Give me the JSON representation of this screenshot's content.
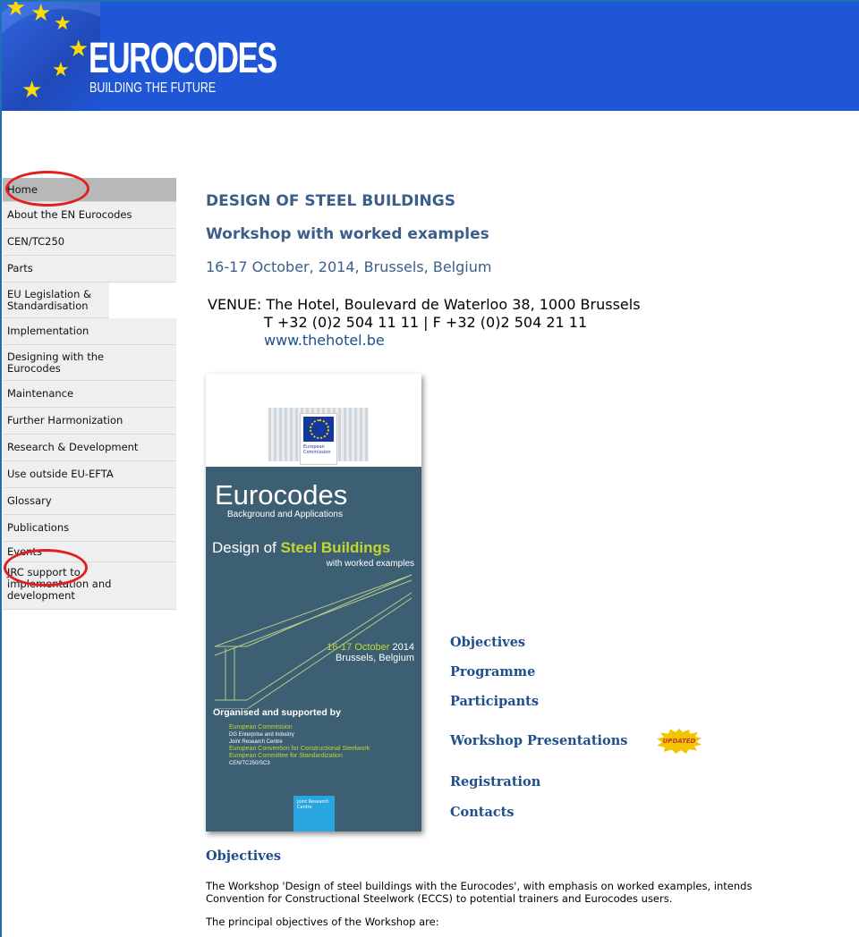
{
  "banner": {
    "logo_title": "EUROCODES",
    "logo_subtitle": "BUILDING THE FUTURE",
    "color": "#1e56d6"
  },
  "sidebar": {
    "items": [
      {
        "label": "Home"
      },
      {
        "label": "About the EN Eurocodes"
      },
      {
        "label": "CEN/TC250"
      },
      {
        "label": "Parts"
      },
      {
        "label": "EU Legislation & Standardisation"
      },
      {
        "label": "Implementation"
      },
      {
        "label": "Designing with the Eurocodes"
      },
      {
        "label": "Maintenance"
      },
      {
        "label": "Further Harmonization"
      },
      {
        "label": "Research & Development"
      },
      {
        "label": "Use outside EU-EFTA"
      },
      {
        "label": "Glossary"
      },
      {
        "label": "Publications"
      },
      {
        "label": "Events"
      },
      {
        "label": "JRC support to implementation and development"
      }
    ]
  },
  "main": {
    "title": "DESIGN OF STEEL BUILDINGS",
    "subtitle": "Workshop with worked examples",
    "dateline": "16-17 October, 2014, Brussels, Belgium",
    "venue_line1": "VENUE: The Hotel, Boulevard de Waterloo 38, 1000 Brussels",
    "venue_line2": "T +32 (0)2 504 11 11 | F +32 (0)2 504 21 11",
    "venue_link": "www.thehotel.be",
    "flyer": {
      "eu_label": "European Commission",
      "title": "Eurocodes",
      "subtitle": "Background and Applications",
      "design_prefix": "Design of ",
      "design_emph": "Steel Buildings",
      "worked": "with worked examples",
      "date_green": "16-17 October",
      "date_year": " 2014",
      "place": "Brussels, Belgium",
      "organised": "Organised and supported by",
      "org1": "European Commission",
      "org1a": "DG Enterprise and Industry",
      "org1b": "Joint Research Centre",
      "org2": "European Convention for Constructional Steelwork",
      "org3": "European Committee for Standardization",
      "org3a": "CEN/TC250/SC3",
      "jrc": "Joint Research Centre"
    },
    "links": [
      {
        "label": "Objectives"
      },
      {
        "label": "Programme"
      },
      {
        "label": "Participants"
      },
      {
        "label": "Workshop Presentations"
      },
      {
        "label": "Registration"
      },
      {
        "label": "Contacts"
      }
    ],
    "badge": "UPDATED",
    "objectives_heading": "Objectives",
    "objectives_p1_line1": "The Workshop 'Design of steel buildings with the Eurocodes', with emphasis on worked examples, intends",
    "objectives_p1_line2": "Convention for Constructional Steelwork (ECCS) to potential trainers and Eurocodes users.",
    "objectives_p2": "The principal objectives of the Workshop are:"
  }
}
